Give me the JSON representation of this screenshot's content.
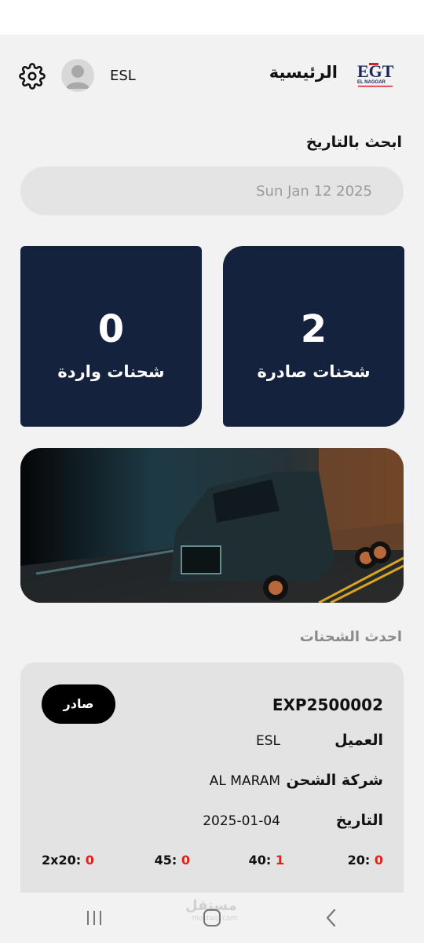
{
  "header": {
    "title": "الرئيسية",
    "username": "ESL",
    "logo_text": "EGT",
    "logo_subtext": "EL NAGGAR"
  },
  "search": {
    "label": "ابحث بالتاريخ",
    "date_value": "Sun Jan 12 2025"
  },
  "stats": {
    "outgoing": {
      "value": "2",
      "label": "شحنات صادرة"
    },
    "incoming": {
      "value": "0",
      "label": "شحنات واردة"
    }
  },
  "latest": {
    "title": "احدث الشحنات",
    "shipment": {
      "id": "EXP2500002",
      "badge": "صادر",
      "client_label": "العميل",
      "client_value": "ESL",
      "carrier_label": "شركة الشحن",
      "carrier_value": "AL MARAM",
      "date_label": "التاريخ",
      "date_value": "2025-01-04",
      "containers": [
        {
          "label": "20:",
          "value": "0"
        },
        {
          "label": "40:",
          "value": "1"
        },
        {
          "label": "45:",
          "value": "0"
        },
        {
          "label": "2x20:",
          "value": "0"
        }
      ]
    }
  },
  "watermark": {
    "text": "مستقل",
    "sub": "mostaql.com"
  },
  "colors": {
    "card": "#15223e",
    "accent_red": "#e0201a",
    "badge": "#000000"
  }
}
